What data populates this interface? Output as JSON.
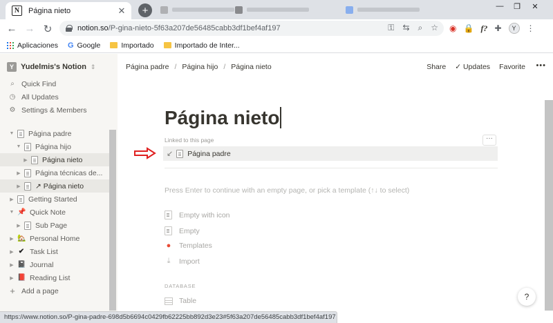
{
  "browser": {
    "tab_title": "Página nieto",
    "tab_close": "✕",
    "new_tab": "+",
    "url_host": "notion.so",
    "url_path": "/P-gina-nieto-5f63a207de56485cabb3df1bef4af197",
    "profile_initial": "Y",
    "status_url": "https://www.notion.so/P-gina-padre-698d5b6694c0429fb62225bb892d3e23#5f63a207de56485cabb3df1bef4af197",
    "bookmarks": [
      {
        "label": "Aplicaciones",
        "icon": "apps-icon"
      },
      {
        "label": "Google",
        "icon": "google-icon"
      },
      {
        "label": "Importado",
        "icon": "folder-icon"
      },
      {
        "label": "Importado de Inter...",
        "icon": "folder-icon"
      }
    ]
  },
  "sidebar": {
    "workspace": "Yudelmis's Notion",
    "workspace_initial": "Y",
    "quick_links": [
      {
        "label": "Quick Find",
        "icon": "search-icon"
      },
      {
        "label": "All Updates",
        "icon": "clock-icon"
      },
      {
        "label": "Settings & Members",
        "icon": "gear-icon"
      }
    ],
    "pages": [
      {
        "label": "Página padre",
        "level": 0,
        "toggle": "▼",
        "icon": "page-icon",
        "selected": false
      },
      {
        "label": "Página hijo",
        "level": 1,
        "toggle": "▼",
        "icon": "page-icon",
        "selected": false
      },
      {
        "label": "Página nieto",
        "level": 2,
        "toggle": "▶",
        "icon": "page-icon",
        "selected": true
      },
      {
        "label": "Página técnicas de...",
        "level": 1,
        "toggle": "▶",
        "icon": "page-icon",
        "selected": false
      },
      {
        "label": "↗ Página nieto",
        "level": 1,
        "toggle": "▶",
        "icon": "page-icon",
        "selected": true
      },
      {
        "label": "Getting Started",
        "level": 0,
        "toggle": "▶",
        "icon": "page-icon",
        "selected": false
      },
      {
        "label": "Quick Note",
        "level": 0,
        "toggle": "▼",
        "icon": "pin-icon",
        "emoji": "📌",
        "selected": false
      },
      {
        "label": "Sub Page",
        "level": 1,
        "toggle": "▶",
        "icon": "page-icon",
        "selected": false
      },
      {
        "label": "Personal Home",
        "level": 0,
        "toggle": "▶",
        "icon": "house-icon",
        "emoji": "🏡",
        "selected": false
      },
      {
        "label": "Task List",
        "level": 0,
        "toggle": "▶",
        "icon": "check-icon",
        "emoji": "✔",
        "selected": false
      },
      {
        "label": "Journal",
        "level": 0,
        "toggle": "▶",
        "icon": "journal-icon",
        "emoji": "📓",
        "selected": false
      },
      {
        "label": "Reading List",
        "level": 0,
        "toggle": "▶",
        "icon": "book-icon",
        "emoji": "📕",
        "selected": false
      }
    ],
    "add_page": "Add a page"
  },
  "topbar": {
    "breadcrumbs": [
      "Página padre",
      "Página hijo",
      "Página nieto"
    ],
    "share": "Share",
    "updates": "Updates",
    "favorite": "Favorite",
    "more": "•••"
  },
  "page": {
    "title": "Página nieto",
    "linked_label": "Linked to this page",
    "linked_item": "Página padre",
    "linked_more": "···",
    "hint": "Press Enter to continue with an empty page, or pick a template (↑↓ to select)",
    "templates": [
      "Empty with icon",
      "Empty",
      "Templates",
      "Import"
    ],
    "database_label": "DATABASE",
    "database_items": [
      "Table"
    ],
    "help": "?"
  }
}
